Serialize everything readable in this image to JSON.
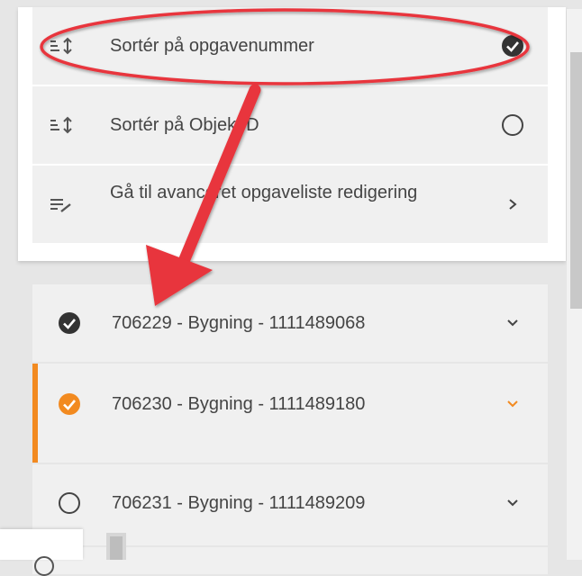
{
  "sort_menu": {
    "items": [
      {
        "label": "Sortér på opgavenummer",
        "icon": "sort-icon",
        "state": "selected"
      },
      {
        "label": "Sortér på ObjektID",
        "icon": "sort-icon",
        "state": "unselected"
      },
      {
        "label": "Gå til avanceret opgaveliste redigering",
        "icon": "edit-list-icon",
        "state": "navigate"
      }
    ]
  },
  "tasks": [
    {
      "label": "706229 - Bygning - 1111489068",
      "status": "completed",
      "active": false
    },
    {
      "label": "706230 - Bygning - 1111489180",
      "status": "completed",
      "active": true
    },
    {
      "label": "706231 - Bygning - 1111489209",
      "status": "not-started",
      "active": false
    }
  ],
  "colors": {
    "accent": "#f28a20",
    "annotation": "#e8343c",
    "check_dark": "#333333"
  }
}
